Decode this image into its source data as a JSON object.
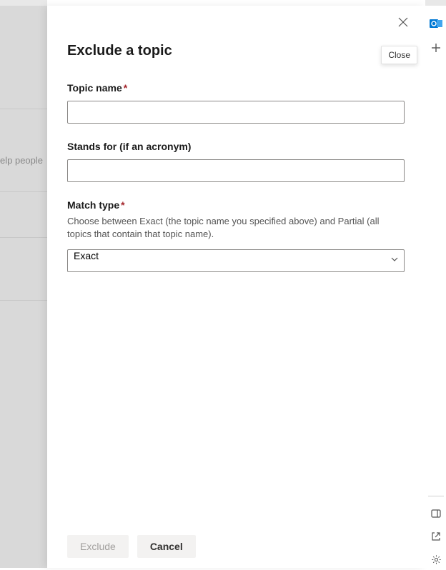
{
  "panel": {
    "title": "Exclude a topic",
    "close_tooltip": "Close"
  },
  "fields": {
    "topic_name": {
      "label": "Topic name",
      "required": "*",
      "value": ""
    },
    "stands_for": {
      "label": "Stands for (if an acronym)",
      "value": ""
    },
    "match_type": {
      "label": "Match type",
      "required": "*",
      "help": "Choose between Exact (the topic name you specified above) and Partial (all topics that contain that topic name).",
      "selected": "Exact"
    }
  },
  "footer": {
    "exclude_label": "Exclude",
    "cancel_label": "Cancel"
  },
  "background": {
    "partial_text": "elp people"
  }
}
